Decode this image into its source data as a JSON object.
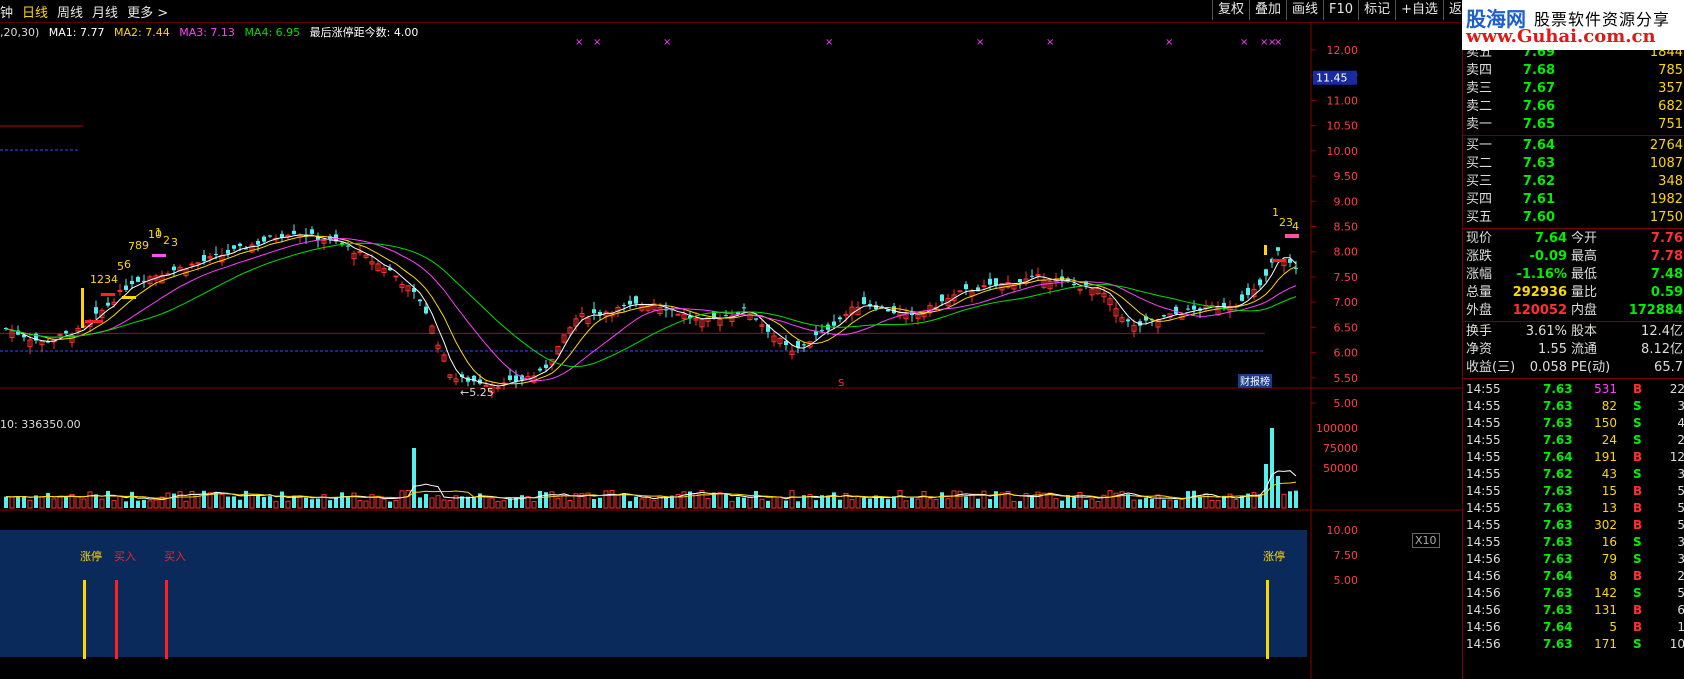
{
  "toolbar": {
    "left_tabs": [
      {
        "label": "钟",
        "active": false
      },
      {
        "label": "日线",
        "active": true
      },
      {
        "label": "周线",
        "active": false
      },
      {
        "label": "月线",
        "active": false
      },
      {
        "label": "更多 >",
        "active": false
      }
    ],
    "right_buttons": [
      "复权",
      "叠加",
      "画线",
      "F10",
      "标记",
      "+自选",
      "返回"
    ]
  },
  "logo": {
    "line1_main": "股海网",
    "line1_tail": "股票软件资源分享",
    "line2": "www.Guhai.com.cn"
  },
  "ma_legend": {
    "params": ",20,30)",
    "ma1": "MA1: 7.77",
    "ma2": "MA2: 7.44",
    "ma3": "MA3: 7.13",
    "ma4": "MA4: 6.95",
    "note": "最后涨停距今数: 4.00",
    "colors": {
      "ma1": "#ffffff",
      "ma2": "#ffd700",
      "ma3": "#ff40ff",
      "ma4": "#00e000",
      "note": "#ffffff"
    }
  },
  "price_axis": {
    "labels": [
      "12.00",
      "11.50",
      "11.00",
      "10.50",
      "10.00",
      "9.50",
      "9.00",
      "8.50",
      "8.00",
      "7.50",
      "7.00",
      "6.50",
      "6.00",
      "5.50",
      "5.00"
    ],
    "highlight": "11.45"
  },
  "chart_annotations": {
    "low_label": "←5.25",
    "finance_tag": "财报榜",
    "marker_s": "S",
    "count_left": [
      "1",
      "2",
      "3",
      "4",
      "5",
      "6",
      "7",
      "8",
      "9",
      "10",
      "1",
      "2",
      "3"
    ],
    "count_right": [
      "1",
      "2",
      "3",
      "4"
    ]
  },
  "volume": {
    "legend": "10: 336350.00",
    "axis": [
      "100000",
      "75000",
      "50000"
    ],
    "unit": "X10"
  },
  "indicator": {
    "axis": [
      "10.00",
      "7.50",
      "5.00"
    ],
    "signals": [
      {
        "label": "涨停",
        "color": "#ffd700"
      },
      {
        "label": "买入",
        "color": "#ff2020"
      },
      {
        "label": "买入",
        "color": "#ff2020"
      },
      {
        "label": "涨停",
        "color": "#ffd700"
      }
    ]
  },
  "order_book": {
    "asks": [
      {
        "label": "卖五",
        "price": "7.69",
        "vol": "1844"
      },
      {
        "label": "卖四",
        "price": "7.68",
        "vol": "785"
      },
      {
        "label": "卖三",
        "price": "7.67",
        "vol": "357"
      },
      {
        "label": "卖二",
        "price": "7.66",
        "vol": "682"
      },
      {
        "label": "卖一",
        "price": "7.65",
        "vol": "751"
      }
    ],
    "bids": [
      {
        "label": "买一",
        "price": "7.64",
        "vol": "2764"
      },
      {
        "label": "买二",
        "price": "7.63",
        "vol": "1087"
      },
      {
        "label": "买三",
        "price": "7.62",
        "vol": "348"
      },
      {
        "label": "买四",
        "price": "7.61",
        "vol": "1982"
      },
      {
        "label": "买五",
        "price": "7.60",
        "vol": "1750"
      }
    ]
  },
  "quote": [
    {
      "l1": "现价",
      "v1": "7.64",
      "c1": "#00ee00",
      "l2": "今开",
      "v2": "7.76",
      "c2": "#ff3030"
    },
    {
      "l1": "涨跌",
      "v1": "-0.09",
      "c1": "#00ee00",
      "l2": "最高",
      "v2": "7.78",
      "c2": "#ff3030"
    },
    {
      "l1": "涨幅",
      "v1": "-1.16%",
      "c1": "#00ee00",
      "l2": "最低",
      "v2": "7.48",
      "c2": "#00ee00"
    },
    {
      "l1": "总量",
      "v1": "292936",
      "c1": "#ffd700",
      "l2": "量比",
      "v2": "0.59",
      "c2": "#00ee00"
    },
    {
      "l1": "外盘",
      "v1": "120052",
      "c1": "#ff3030",
      "l2": "内盘",
      "v2": "172884",
      "c2": "#00ee00"
    }
  ],
  "fundamentals": [
    {
      "l1": "换手",
      "v1": "3.61%",
      "l2": "股本",
      "v2": "12.4亿"
    },
    {
      "l1": "净资",
      "v1": "1.55",
      "l2": "流通",
      "v2": "8.12亿"
    },
    {
      "l1": "收益(三)",
      "v1": "0.058",
      "l2": "PE(动)",
      "v2": "65.7"
    }
  ],
  "ticks": [
    {
      "time": "14:55",
      "price": "7.63",
      "vol": "531",
      "side": "B",
      "n": "22"
    },
    {
      "time": "14:55",
      "price": "7.63",
      "vol": "82",
      "side": "S",
      "n": "3"
    },
    {
      "time": "14:55",
      "price": "7.63",
      "vol": "150",
      "side": "S",
      "n": "4"
    },
    {
      "time": "14:55",
      "price": "7.63",
      "vol": "24",
      "side": "S",
      "n": "2"
    },
    {
      "time": "14:55",
      "price": "7.64",
      "vol": "191",
      "side": "B",
      "n": "12"
    },
    {
      "time": "14:55",
      "price": "7.62",
      "vol": "43",
      "side": "S",
      "n": "3"
    },
    {
      "time": "14:55",
      "price": "7.63",
      "vol": "15",
      "side": "B",
      "n": "5"
    },
    {
      "time": "14:55",
      "price": "7.63",
      "vol": "13",
      "side": "B",
      "n": "5"
    },
    {
      "time": "14:55",
      "price": "7.63",
      "vol": "302",
      "side": "B",
      "n": "5"
    },
    {
      "time": "14:55",
      "price": "7.63",
      "vol": "16",
      "side": "S",
      "n": "3"
    },
    {
      "time": "14:56",
      "price": "7.63",
      "vol": "79",
      "side": "S",
      "n": "3"
    },
    {
      "time": "14:56",
      "price": "7.64",
      "vol": "8",
      "side": "B",
      "n": "2"
    },
    {
      "time": "14:56",
      "price": "7.63",
      "vol": "142",
      "side": "S",
      "n": "5"
    },
    {
      "time": "14:56",
      "price": "7.63",
      "vol": "131",
      "side": "B",
      "n": "6"
    },
    {
      "time": "14:56",
      "price": "7.64",
      "vol": "5",
      "side": "B",
      "n": "1"
    },
    {
      "time": "14:56",
      "price": "7.63",
      "vol": "171",
      "side": "S",
      "n": "10"
    }
  ]
}
